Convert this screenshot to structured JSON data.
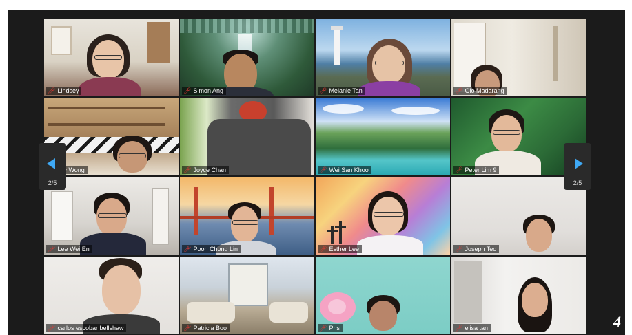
{
  "participants": [
    {
      "name": "Lindsey"
    },
    {
      "name": "Simon Ang"
    },
    {
      "name": "Melanie Tan"
    },
    {
      "name": "Glo Madarang"
    },
    {
      "name": "…y Wong"
    },
    {
      "name": "Joyce Chan"
    },
    {
      "name": "Wei San Khoo"
    },
    {
      "name": "Peter Lim 9"
    },
    {
      "name": "Lee Wei En"
    },
    {
      "name": "Poon Chong Lin"
    },
    {
      "name": "Esther Lee"
    },
    {
      "name": "Joseph Teo"
    },
    {
      "name": "carlos escobar bellshaw"
    },
    {
      "name": "Patricia Boo"
    },
    {
      "name": "Pris"
    },
    {
      "name": "elisa tan"
    }
  ],
  "navigation": {
    "prev_page": "2/5",
    "next_page": "2/5"
  },
  "figure_number": "4",
  "icons": {
    "mic": "mic-muted-icon",
    "prev": "prev-page-arrow-icon",
    "next": "next-page-arrow-icon"
  },
  "colors": {
    "background": "#1b1b1b",
    "arrow": "#3fa9f5",
    "muted_mic": "#e53935"
  }
}
